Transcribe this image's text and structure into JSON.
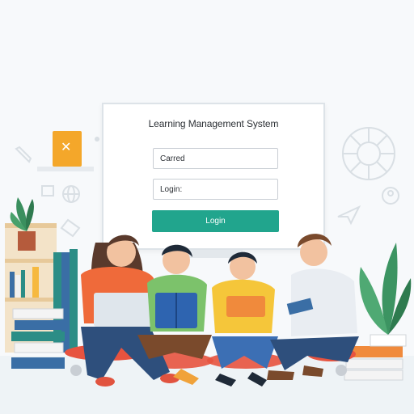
{
  "login_panel": {
    "title": "Learning Management System",
    "field_username": "Carred",
    "field_password": "Login:",
    "login_label": "Login"
  },
  "icons": [
    "shelf-book-icon",
    "pencil-icon",
    "globe-icon",
    "clock-icon",
    "paper-plane-icon",
    "person-icon",
    "puzzle-icon",
    "chart-icon"
  ],
  "colors": {
    "accent": "#21a58d",
    "background": "#f7f9fb"
  }
}
